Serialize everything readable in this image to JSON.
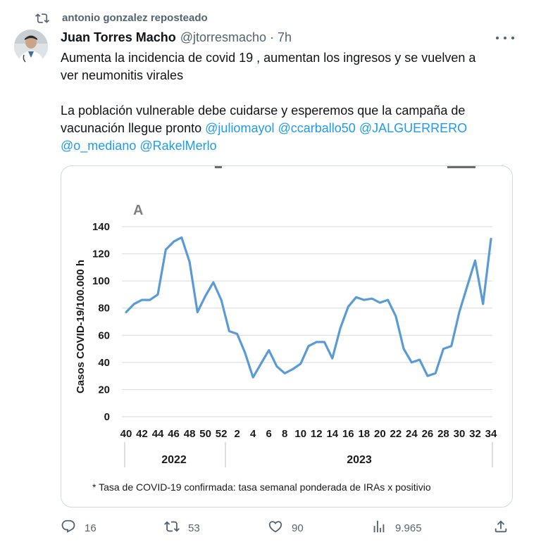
{
  "repost": {
    "label": "antonio gonzalez reposteado"
  },
  "tweet": {
    "author_name": "Juan Torres Macho",
    "handle": "@jtorresmacho",
    "separator": "·",
    "time": "7h",
    "line1": "Aumenta la incidencia de covid 19 , aumentan los ingresos y se vuelven a",
    "line2": "ver neumonitis virales",
    "line3": "La población vulnerable debe cuidarse y esperemos que la campaña de",
    "line4_text": "vacunación llegue pronto ",
    "mentions": [
      "@juliomayol",
      "@ccarballo50",
      "@JALGUERRERO",
      "@o_mediano",
      "@RakelMerlo"
    ]
  },
  "actions": {
    "replies": "16",
    "reposts": "53",
    "likes": "90",
    "views": "9.965"
  },
  "icons": {
    "repost": "repost-icon",
    "more": "more-icon",
    "reply": "reply-icon",
    "like": "heart-icon",
    "views": "views-icon",
    "share": "share-icon"
  },
  "colors": {
    "text": "#0f1419",
    "secondary": "#536471",
    "link": "#1d9bf0",
    "border": "#cfd9de",
    "series": "#5b9bd5"
  },
  "chart_data": {
    "type": "line",
    "panel_label": "A",
    "ylabel": "Casos COVID-19/100.000 h",
    "ylim": [
      0,
      140
    ],
    "yticks": [
      "0",
      "20",
      "40",
      "60",
      "80",
      "100",
      "120",
      "140"
    ],
    "grid": true,
    "week_labels": [
      "40",
      "42",
      "44",
      "46",
      "48",
      "50",
      "52",
      "2",
      "4",
      "6",
      "8",
      "10",
      "12",
      "14",
      "16",
      "18",
      "20",
      "22",
      "24",
      "26",
      "28",
      "30",
      "32",
      "34"
    ],
    "year_labels": [
      "2022",
      "2023"
    ],
    "footnote": "* Tasa de COVID-19 confirmada: tasa semanal ponderada de IRAs x positivio",
    "x_points": [
      "40",
      "41",
      "42",
      "43",
      "44",
      "45",
      "46",
      "47",
      "48",
      "49",
      "50",
      "51",
      "52",
      "1",
      "2",
      "3",
      "4",
      "5",
      "6",
      "7",
      "8",
      "9",
      "10",
      "11",
      "12",
      "13",
      "14",
      "15",
      "16",
      "17",
      "18",
      "19",
      "20",
      "21",
      "22",
      "23",
      "24",
      "25",
      "26",
      "27",
      "28",
      "29",
      "30",
      "31",
      "32",
      "33",
      "34"
    ],
    "values": [
      77,
      83,
      86,
      86,
      90,
      123,
      129,
      132,
      114,
      77,
      89,
      99,
      86,
      63,
      61,
      47,
      29,
      39,
      49,
      37,
      32,
      35,
      39,
      52,
      55,
      55,
      43,
      65,
      81,
      88,
      86,
      87,
      84,
      86,
      74,
      50,
      40,
      42,
      30,
      32,
      50,
      52,
      77,
      96,
      115,
      83,
      131
    ]
  }
}
